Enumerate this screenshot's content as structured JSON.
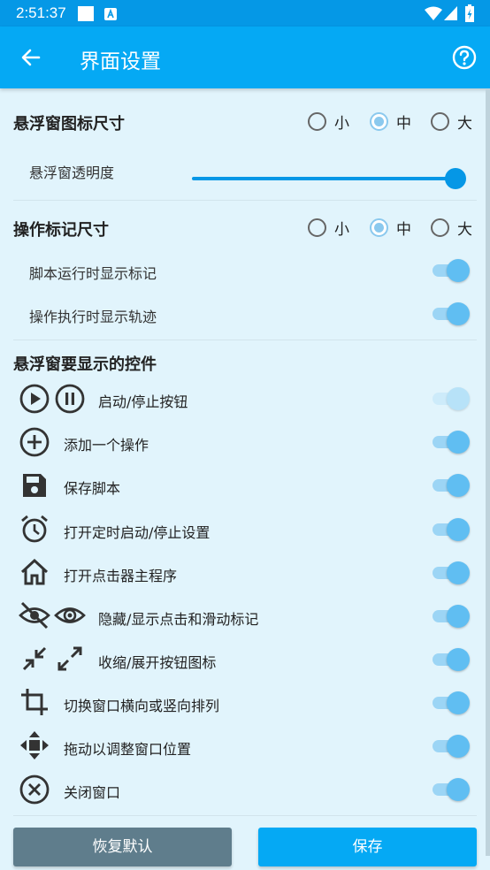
{
  "status_bar": {
    "time": "2:51:37"
  },
  "app_bar": {
    "title": "界面设置"
  },
  "floating_icon_size": {
    "title": "悬浮窗图标尺寸",
    "options": [
      "小",
      "中",
      "大"
    ],
    "selected": "中"
  },
  "opacity": {
    "label": "悬浮窗透明度",
    "value_fraction": 1.0
  },
  "marker_size": {
    "title": "操作标记尺寸",
    "options": [
      "小",
      "中",
      "大"
    ],
    "selected": "中",
    "toggles": [
      {
        "label": "脚本运行时显示标记",
        "on": true
      },
      {
        "label": "操作执行时显示轨迹",
        "on": true
      }
    ]
  },
  "controls": {
    "title": "悬浮窗要显示的控件",
    "items": [
      {
        "label": "启动/停止按钮",
        "icons": [
          "play-circle-icon",
          "pause-circle-icon"
        ],
        "on": true,
        "disabled": true
      },
      {
        "label": "添加一个操作",
        "icons": [
          "add-circle-icon"
        ],
        "on": true,
        "disabled": false
      },
      {
        "label": "保存脚本",
        "icons": [
          "save-icon"
        ],
        "on": true,
        "disabled": false
      },
      {
        "label": "打开定时启动/停止设置",
        "icons": [
          "alarm-icon"
        ],
        "on": true,
        "disabled": false
      },
      {
        "label": "打开点击器主程序",
        "icons": [
          "home-icon"
        ],
        "on": true,
        "disabled": false
      },
      {
        "label": "隐藏/显示点击和滑动标记",
        "icons": [
          "eye-off-icon",
          "eye-icon"
        ],
        "on": true,
        "disabled": false
      },
      {
        "label": "收缩/展开按钮图标",
        "icons": [
          "collapse-icon",
          "expand-icon"
        ],
        "on": true,
        "disabled": false
      },
      {
        "label": "切换窗口横向或竖向排列",
        "icons": [
          "crop-rotate-icon"
        ],
        "on": true,
        "disabled": false
      },
      {
        "label": "拖动以调整窗口位置",
        "icons": [
          "move-icon"
        ],
        "on": true,
        "disabled": false
      },
      {
        "label": "关闭窗口",
        "icons": [
          "close-circle-icon"
        ],
        "on": true,
        "disabled": false
      }
    ]
  },
  "buttons": {
    "restore": "恢复默认",
    "save": "保存"
  },
  "colors": {
    "status_bar": "#0598E6",
    "app_bar": "#05A9F4",
    "background": "#E1F4FC",
    "accent": "#0597E6",
    "restore_button": "#5F7D8C"
  }
}
